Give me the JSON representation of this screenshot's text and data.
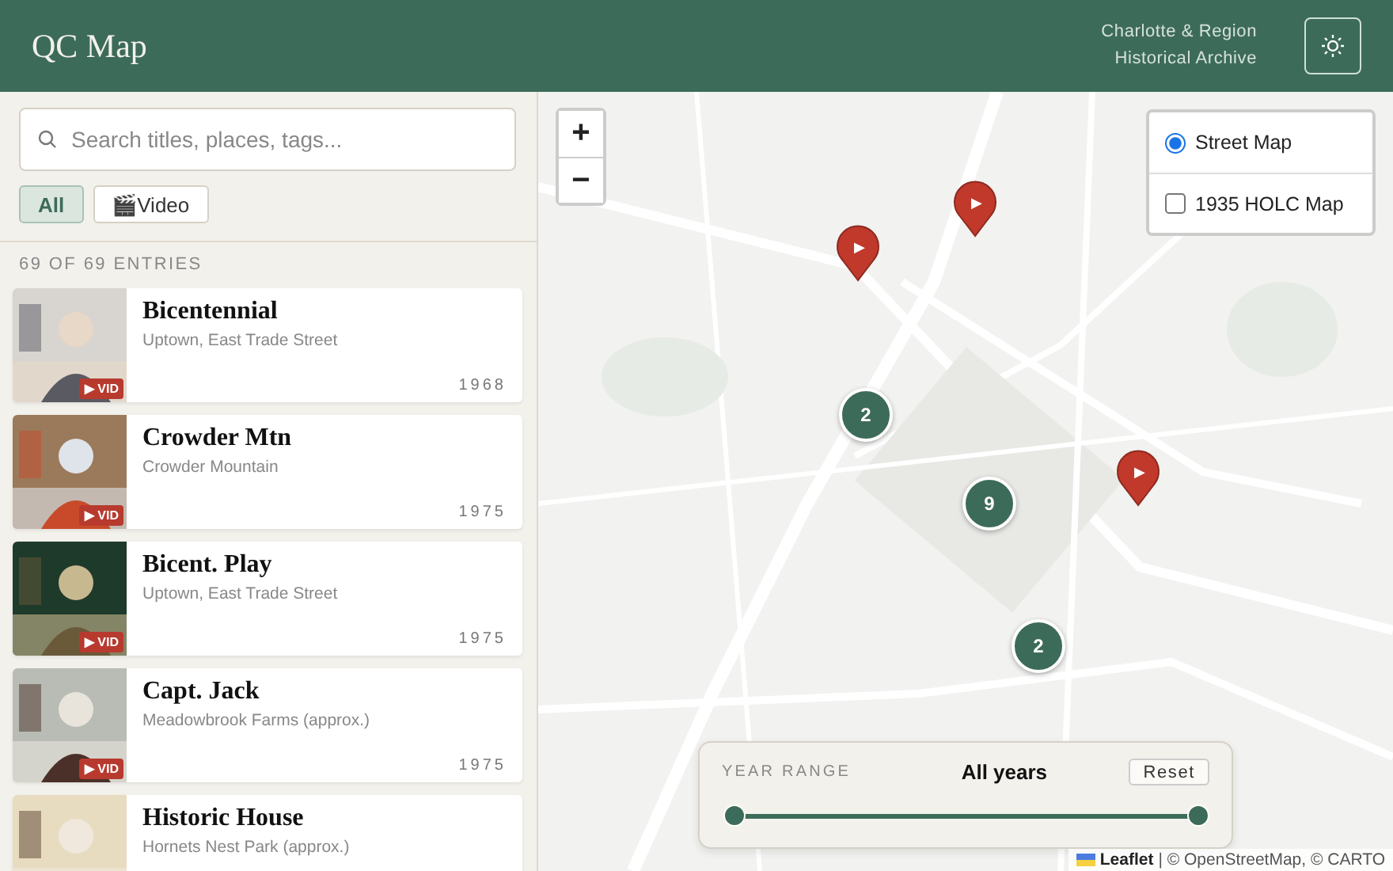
{
  "header": {
    "title": "QC Map",
    "subtitle_lines": [
      "Charlotte & Region",
      "Historical Archive"
    ]
  },
  "sidebar": {
    "search": {
      "placeholder": "Search titles, places, tags..."
    },
    "filters": [
      {
        "label": "All",
        "selected": true
      },
      {
        "label": "🎬Video",
        "selected": false
      }
    ],
    "count": "69 OF 69 ENTRIES",
    "entries": [
      {
        "title": "Bicentennial",
        "place": "Uptown, East Trade Street",
        "year": "1968",
        "badge": "▶ VID"
      },
      {
        "title": "Crowder Mtn",
        "place": "Crowder Mountain",
        "year": "1975",
        "badge": "▶ VID"
      },
      {
        "title": "Bicent. Play",
        "place": "Uptown, East Trade Street",
        "year": "1975",
        "badge": "▶ VID"
      },
      {
        "title": "Capt. Jack",
        "place": "Meadowbrook Farms (approx.)",
        "year": "1975",
        "badge": "▶ VID"
      },
      {
        "title": "Historic House",
        "place": "Hornets Nest Park (approx.)"
      }
    ]
  },
  "map": {
    "zoom": [
      "+",
      "−"
    ],
    "layers": [
      {
        "kind": "radio",
        "label": "Street Map",
        "selected": true
      },
      {
        "kind": "checkbox",
        "label": "1935 HOLC Map",
        "checked": false
      }
    ],
    "markers": [
      {
        "kind": "pin",
        "icon": "▶"
      },
      {
        "kind": "pin",
        "icon": "▶"
      },
      {
        "kind": "pin",
        "icon": "▶"
      },
      {
        "kind": "cluster",
        "count": "2"
      },
      {
        "kind": "cluster",
        "count": "9"
      },
      {
        "kind": "cluster",
        "count": "2"
      }
    ],
    "year_range": {
      "label": "YEAR RANGE",
      "value": "All years",
      "reset": "Reset",
      "start": {
        "level": 0
      },
      "end": {
        "level": 1
      }
    },
    "attribution": {
      "link": "Leaflet",
      "text": "| © OpenStreetMap, © CARTO"
    }
  }
}
